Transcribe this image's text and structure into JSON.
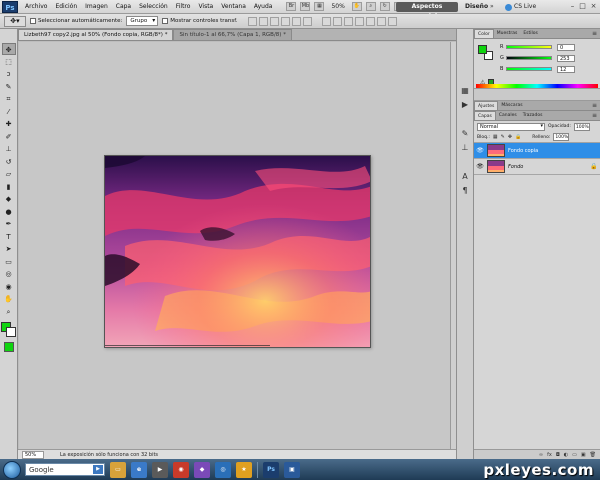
{
  "app": {
    "logo": "Ps",
    "menu": [
      "Archivo",
      "Edición",
      "Imagen",
      "Capa",
      "Selección",
      "Filtro",
      "Vista",
      "Ventana",
      "Ayuda"
    ],
    "zoom_menu": "50%",
    "workspace_active": "Aspectos esenciales",
    "workspace_alt": "Diseño",
    "workspace_more": "»",
    "cs_live": "CS Live",
    "window_controls": [
      "–",
      "□",
      "×"
    ]
  },
  "options": {
    "auto_select_label": "Seleccionar automáticamente:",
    "auto_select_value": "Grupo",
    "show_transform_label": "Mostrar controles transf."
  },
  "documents": {
    "tabs": [
      {
        "label": "Lizbeth97 copy2.jpg al 50% (Fondo copia, RGB/8*) *",
        "active": true
      },
      {
        "label": "Sin título-1 al 66,7% (Capa 1, RGB/8) *",
        "active": false
      }
    ]
  },
  "status": {
    "zoom": "50%",
    "info": "La exposición sólo funciona con 32 bits"
  },
  "color_panel": {
    "tabs": [
      "Color",
      "Muestras",
      "Estilos"
    ],
    "fg_color": "#10d410",
    "sliders": [
      {
        "label": "R",
        "value": "0"
      },
      {
        "label": "G",
        "value": "253"
      },
      {
        "label": "B",
        "value": "12"
      }
    ]
  },
  "adjust_panel": {
    "tabs": [
      "Ajustes",
      "Máscaras"
    ]
  },
  "layers_panel": {
    "tabs": [
      "Capas",
      "Canales",
      "Trazados"
    ],
    "blend_mode": "Normal",
    "opacity_label": "Opacidad:",
    "opacity_value": "100%",
    "lock_label": "Bloq.:",
    "fill_label": "Relleno:",
    "fill_value": "100%",
    "layers": [
      {
        "name": "Fondo copia",
        "selected": true
      },
      {
        "name": "Fondo",
        "selected": false
      }
    ]
  },
  "taskbar": {
    "search_text": "Google",
    "watermark": "pxleyes.com"
  },
  "colors": {
    "accent_selected": "#2f8ee7",
    "foreground": "#10d410"
  }
}
